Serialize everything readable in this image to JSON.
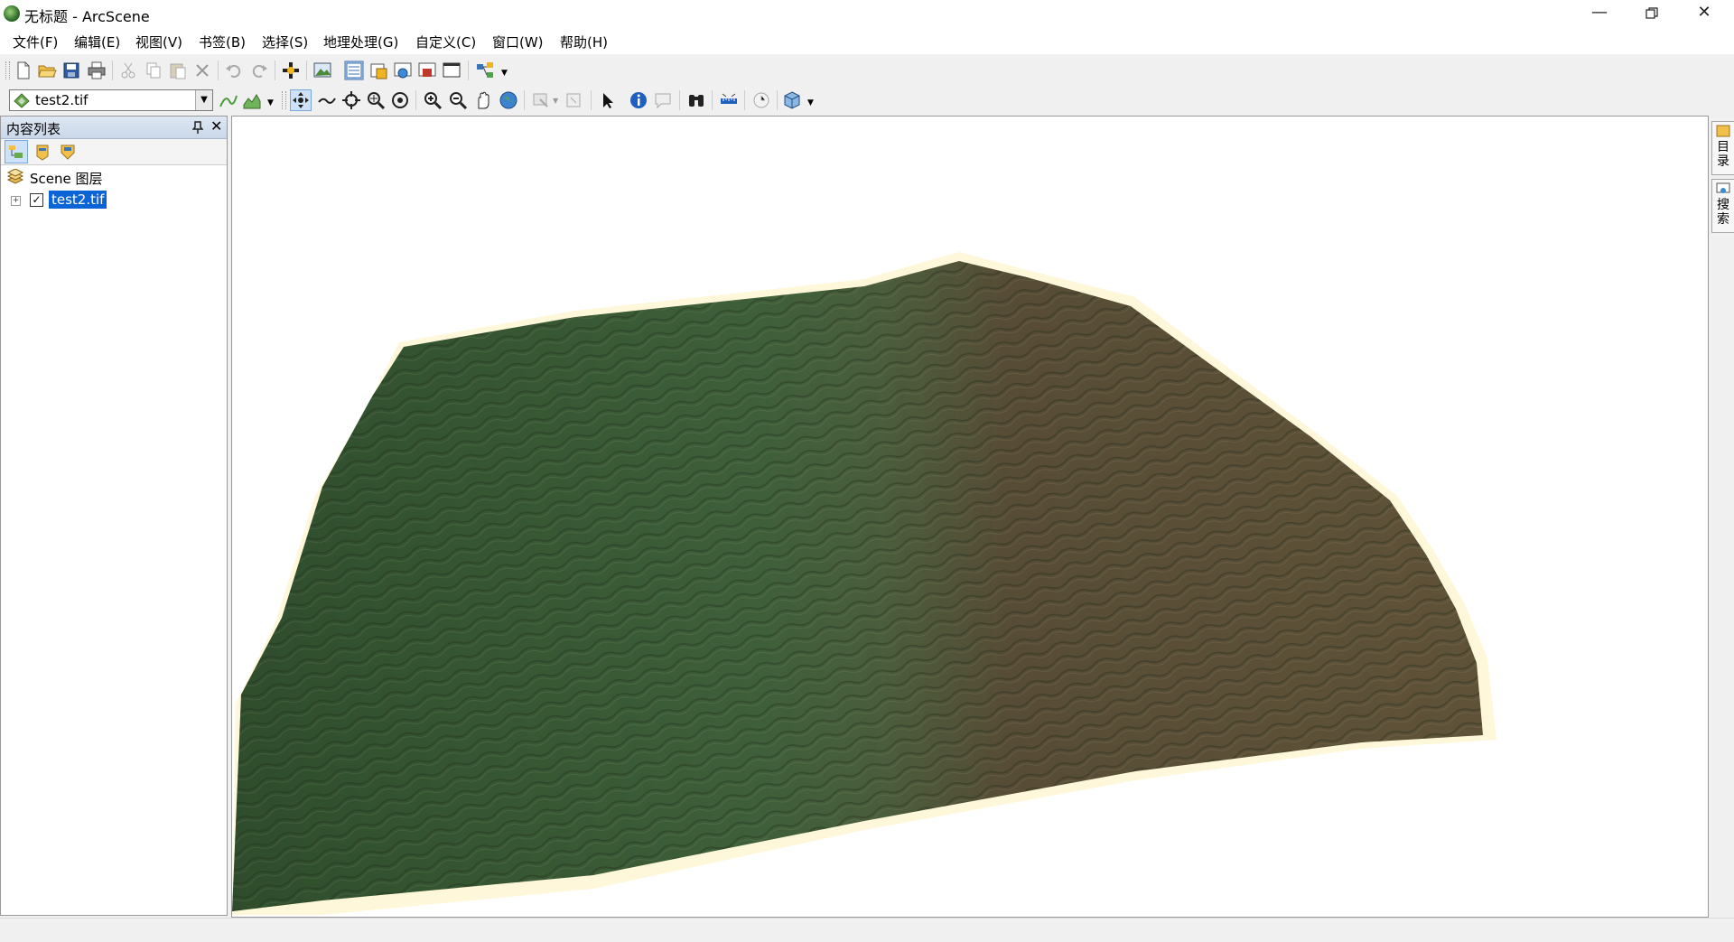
{
  "window": {
    "title": "无标题 - ArcScene"
  },
  "menu": [
    "文件(F)",
    "编辑(E)",
    "视图(V)",
    "书签(B)",
    "选择(S)",
    "地理处理(G)",
    "自定义(C)",
    "窗口(W)",
    "帮助(H)"
  ],
  "toolbar2": {
    "layer_value": "test2.tif"
  },
  "toc": {
    "title": "内容列表",
    "scene_layer_label": "Scene 图层",
    "layers": [
      {
        "name": "test2.tif",
        "checked": true,
        "selected": true
      }
    ]
  },
  "right_dock": {
    "tabs": [
      "目录",
      "搜索"
    ]
  },
  "colors": {
    "selection": "#0a64d6",
    "terrain_green": "#3f5e3a",
    "terrain_brown": "#5b5038",
    "fringe": "#fff7d9"
  }
}
